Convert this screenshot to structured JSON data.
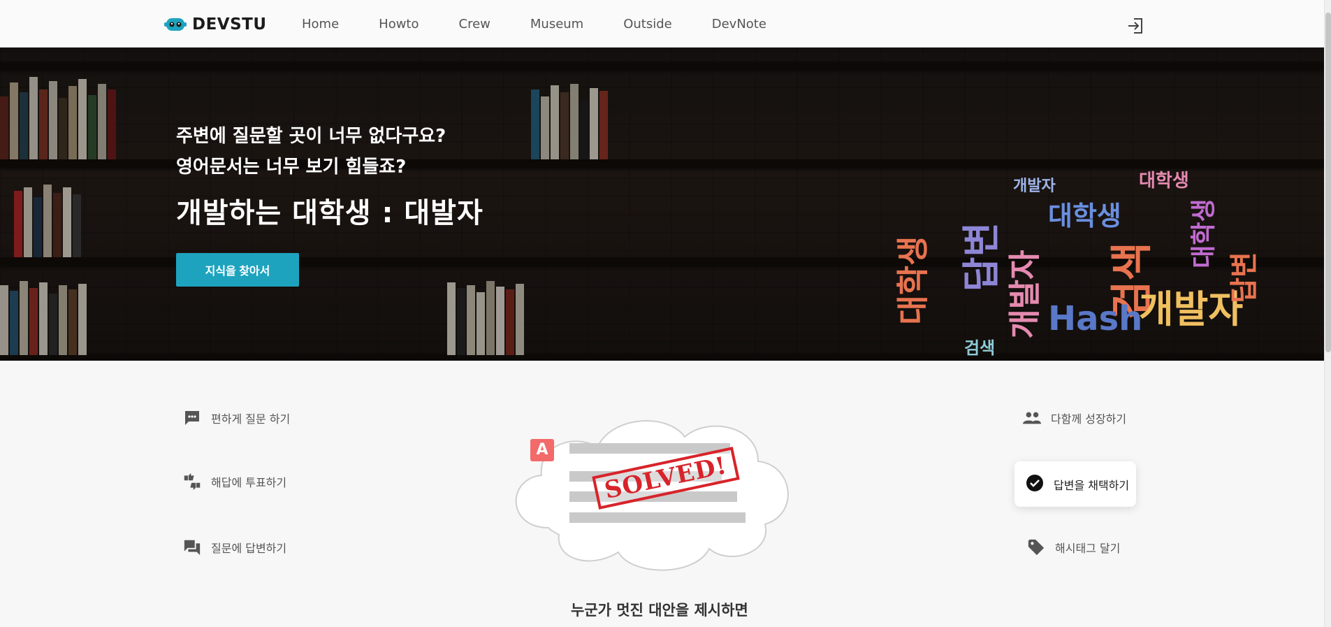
{
  "brand": {
    "name": "DEVSTU",
    "accent": "#1ea3bf"
  },
  "nav": {
    "items": [
      "Home",
      "Howto",
      "Crew",
      "Museum",
      "Outside",
      "DevNote"
    ]
  },
  "header": {
    "login_icon": "login-icon"
  },
  "hero": {
    "line1": "주변에 질문할 곳이 너무 없다구요?",
    "line2": "영어문서는 너무 보기 힘들죠?",
    "title": "개발하는 대학생 : 대발자",
    "cta": "지식을 찾아서",
    "cloud_words": [
      "대학생",
      "답변",
      "개발자",
      "대학생",
      "검색",
      "개발자",
      "Hash",
      "대학생",
      "답변",
      "개발자",
      "대학생",
      "검색"
    ]
  },
  "features": {
    "left": [
      {
        "icon": "chat-dots-icon",
        "label": "편하게 질문 하기"
      },
      {
        "icon": "thumbs-vote-icon",
        "label": "해답에 투표하기"
      },
      {
        "icon": "forum-icon",
        "label": "질문에 답변하기"
      }
    ],
    "right": [
      {
        "icon": "people-icon",
        "label": "다함께 성장하기"
      },
      {
        "icon": "check-circle-icon",
        "label": "답변을 채택하기"
      },
      {
        "icon": "tag-icon",
        "label": "해시태그 달기"
      }
    ]
  },
  "illustration": {
    "badge": "A",
    "stamp": "SOLVED!"
  },
  "caption": "누군가 멋진 대안을 제시하면"
}
